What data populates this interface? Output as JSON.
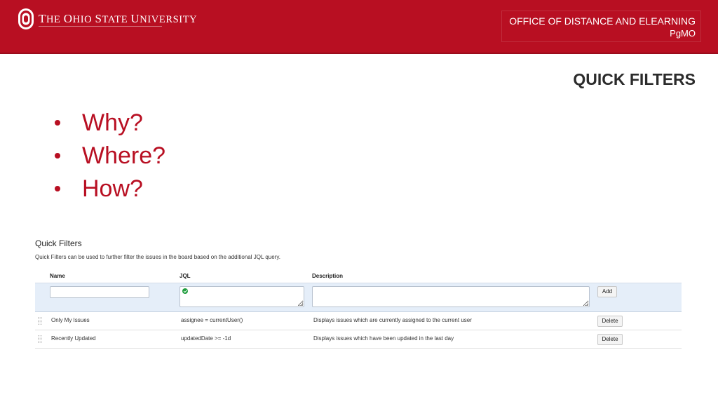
{
  "header": {
    "university_name": "The Ohio State University",
    "department": "OFFICE OF DISTANCE AND ELEARNING",
    "unit": "PgMO",
    "brand_color": "#b80f22"
  },
  "slide": {
    "title": "QUICK FILTERS",
    "bullets": [
      "Why?",
      "Where?",
      "How?"
    ]
  },
  "quick_filters": {
    "title": "Quick Filters",
    "description": "Quick Filters can be used to further filter the issues in the board based on the additional JQL query.",
    "columns": {
      "name": "Name",
      "jql": "JQL",
      "description": "Description"
    },
    "new_filter": {
      "name": "",
      "jql": "",
      "description": "",
      "jql_valid_icon": "check-circle-icon"
    },
    "add_label": "Add",
    "delete_label": "Delete",
    "rows": [
      {
        "name": "Only My Issues",
        "jql": "assignee = currentUser()",
        "description": "Displays issues which are currently assigned to the current user"
      },
      {
        "name": "Recently Updated",
        "jql": "updatedDate >= -1d",
        "description": "Displays issues which have been updated in the last day"
      }
    ]
  }
}
